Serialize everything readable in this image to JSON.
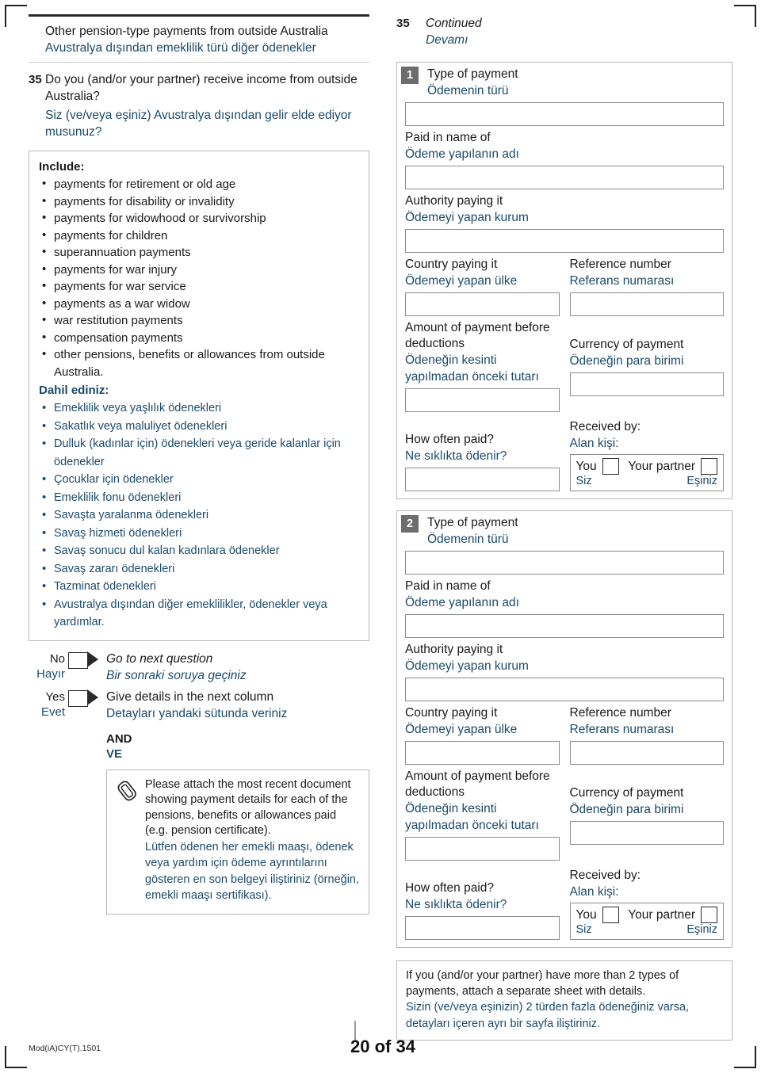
{
  "colors": {
    "turkish_text": "#1b4a6b",
    "english_text": "#1a1a1a",
    "badge_bg": "#6d6d6d",
    "box_border": "#b8b8b8"
  },
  "left": {
    "section_heading": {
      "en": "Other pension-type payments from outside Australia",
      "tr": "Avustralya dışından emeklilik türü diğer ödenekler"
    },
    "question": {
      "number": "35",
      "en": "Do you (and/or your partner) receive income from outside Australia?",
      "tr": "Siz (ve/veya eşiniz) Avustralya dışından gelir elde ediyor musunuz?"
    },
    "include": {
      "heading_en": "Include:",
      "items_en": [
        "payments for retirement or old age",
        "payments for disability or invalidity",
        "payments for widowhood or survivorship",
        "payments for children",
        "superannuation payments",
        "payments for war injury",
        "payments for war service",
        "payments as a war widow",
        "war restitution payments",
        "compensation payments",
        "other pensions, benefits or allowances from outside Australia."
      ],
      "heading_tr": "Dahil ediniz:",
      "items_tr": [
        "Emeklilik veya yaşlılık ödenekleri",
        "Sakatlık veya maluliyet ödenekleri",
        "Dulluk (kadınlar için) ödenekleri veya geride kalanlar için ödenekler",
        "Çocuklar için ödenekler",
        "Emeklilik fonu ödenekleri",
        "Savaşta yaralanma ödenekleri",
        "Savaş hizmeti ödenekleri",
        "Savaş sonucu dul kalan kadınlara ödenekler",
        "Savaş zararı ödenekleri",
        "Tazminat ödenekleri",
        "Avustralya dışından diğer emeklilikler, ödenekler veya yardımlar."
      ]
    },
    "answers": [
      {
        "label_en": "No",
        "label_tr": "Hayır",
        "action_en": "Go to next question",
        "action_tr": "Bir sonraki soruya geçiniz",
        "italic": true
      },
      {
        "label_en": "Yes",
        "label_tr": "Evet",
        "action_en": "Give details in the next column",
        "action_tr": "Detayları yandaki sütunda veriniz",
        "italic": false
      }
    ],
    "and_en": "AND",
    "and_tr": "VE",
    "attach": {
      "icon": "paperclip-icon",
      "en": "Please attach the most recent document showing payment details for each of the pensions, benefits or allowances paid (e.g. pension certificate).",
      "tr": "Lütfen ödenen her emekli maaşı, ödenek veya yardım için ödeme ayrıntılarını gösteren en son belgeyi iliştiriniz (örneğin, emekli maaşı sertifikası)."
    }
  },
  "right": {
    "continued": {
      "number": "35",
      "en": "Continued",
      "tr": "Devamı"
    },
    "labels": {
      "type_of_payment": {
        "en": "Type of payment",
        "tr": "Ödemenin türü"
      },
      "paid_in_name_of": {
        "en": "Paid in name of",
        "tr": "Ödeme yapılanın adı"
      },
      "authority_paying_it": {
        "en": "Authority paying it",
        "tr": "Ödemeyi yapan kurum"
      },
      "country_paying_it": {
        "en": "Country paying it",
        "tr": "Ödemeyi yapan ülke"
      },
      "reference_number": {
        "en": "Reference number",
        "tr": "Referans numarası"
      },
      "amount_before_deductions": {
        "en": "Amount of payment before deductions",
        "tr": "Ödeneğin kesinti yapılmadan önceki tutarı"
      },
      "currency_of_payment": {
        "en": "Currency of payment",
        "tr": "Ödeneğin para birimi"
      },
      "how_often_paid": {
        "en": "How often paid?",
        "tr": "Ne sıklıkta ödenir?"
      },
      "received_by": {
        "en": "Received by:",
        "tr": "Alan kişi:"
      },
      "you": {
        "en": "You",
        "tr": "Siz"
      },
      "your_partner": {
        "en": "Your partner",
        "tr": "Eşiniz"
      }
    },
    "blocks": [
      {
        "badge": "1",
        "values": {
          "type_of_payment": "",
          "paid_in_name_of": "",
          "authority_paying_it": "",
          "country_paying_it": "",
          "reference_number": "",
          "amount_before_deductions": "",
          "currency_of_payment": "",
          "how_often_paid": ""
        }
      },
      {
        "badge": "2",
        "values": {
          "type_of_payment": "",
          "paid_in_name_of": "",
          "authority_paying_it": "",
          "country_paying_it": "",
          "reference_number": "",
          "amount_before_deductions": "",
          "currency_of_payment": "",
          "how_often_paid": ""
        }
      }
    ],
    "note": {
      "en": "If you (and/or your partner) have more than 2 types of payments, attach a separate sheet with details.",
      "tr": "Sizin (ve/veya eşinizin) 2 türden fazla ödeneğiniz varsa, detayları içeren ayrı bir sayfa iliştiriniz."
    }
  },
  "footer": {
    "form_code": "Mod(iA)CY(T).1501",
    "page": "20 of 34"
  }
}
